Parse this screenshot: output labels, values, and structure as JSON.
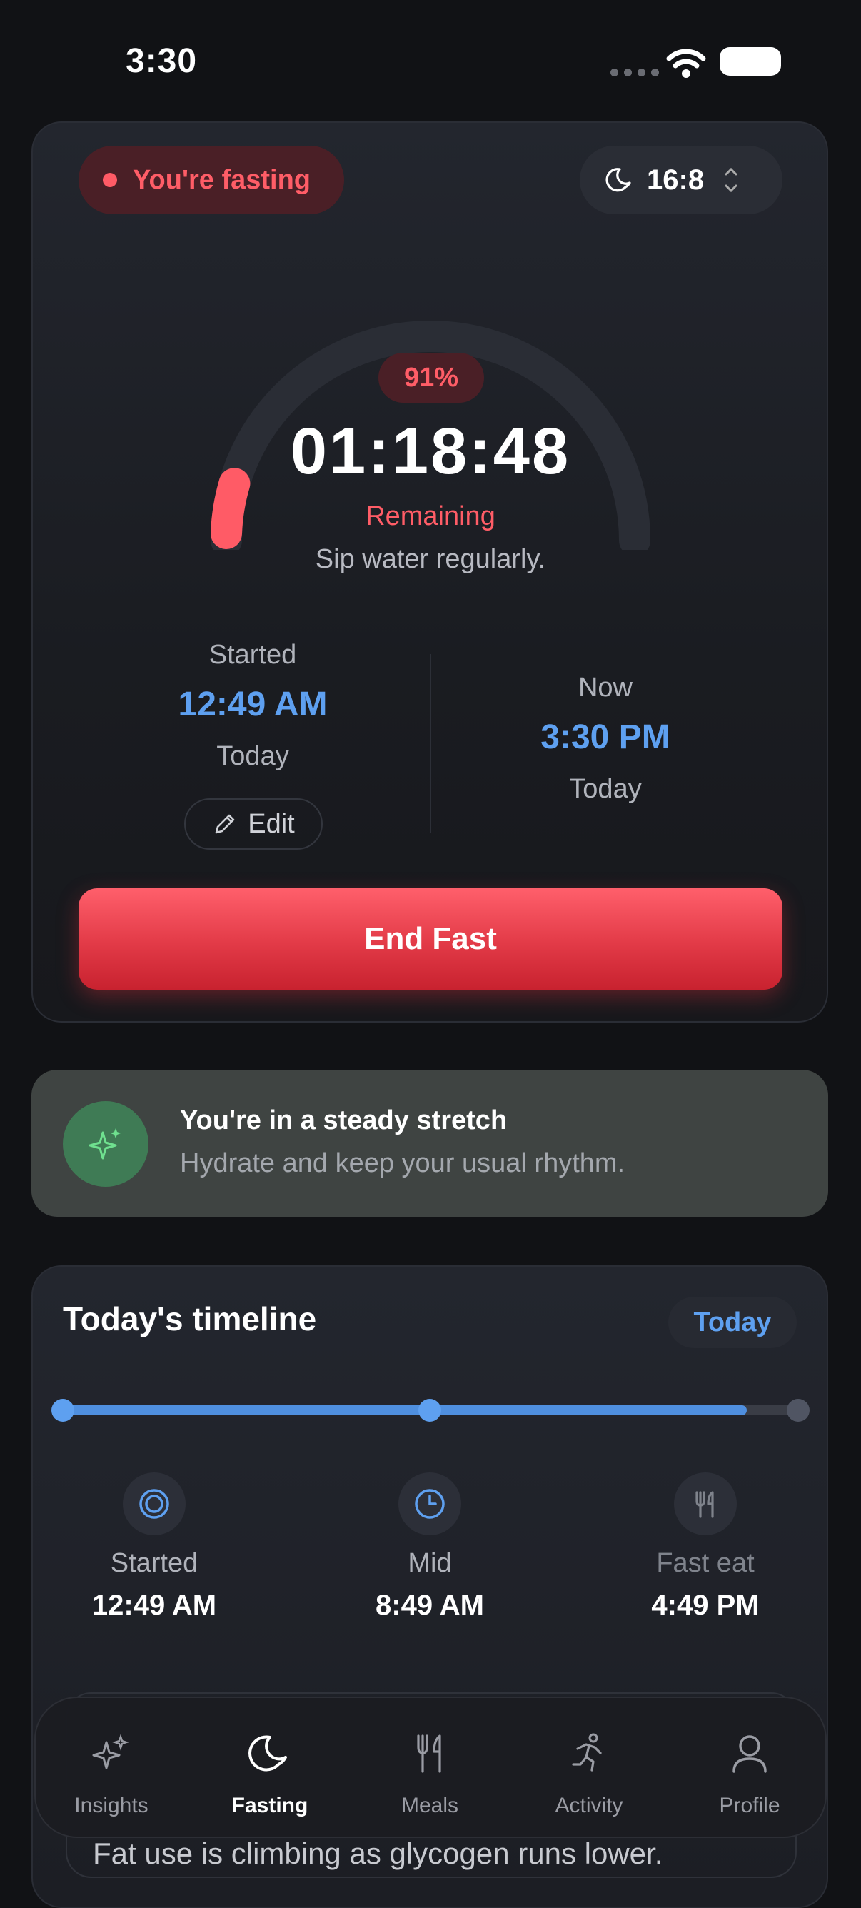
{
  "status_bar": {
    "time": "3:30"
  },
  "fasting_card": {
    "status_pill": "You're fasting",
    "plan": "16:8",
    "progress_percent_label": "91%",
    "progress_fraction": 0.91,
    "countdown": "01:18:48",
    "countdown_label": "Remaining",
    "tip": "Sip water regularly.",
    "started": {
      "label": "Started",
      "time": "12:49 AM",
      "day": "Today",
      "edit_label": "Edit"
    },
    "now": {
      "label": "Now",
      "time": "3:30 PM",
      "day": "Today"
    },
    "end_button": "End Fast",
    "colors": {
      "accent_red": "#ff5b66",
      "accent_blue": "#5ea0f0"
    }
  },
  "insight_card": {
    "title": "You're in a steady stretch",
    "subtitle": "Hydrate and keep your usual rhythm."
  },
  "timeline_card": {
    "title": "Today's timeline",
    "range_button": "Today",
    "progress_fraction": 0.93,
    "milestones": [
      {
        "label": "Started",
        "time": "12:49 AM",
        "icon": "target-icon"
      },
      {
        "label": "Mid",
        "time": "8:49 AM",
        "icon": "clock-icon"
      },
      {
        "label": "Fast eat",
        "time": "4:49 PM",
        "icon": "utensils-icon"
      }
    ],
    "partial_text": "Fat use is climbing as glycogen runs lower."
  },
  "tab_bar": {
    "tabs": [
      {
        "label": "Insights",
        "icon": "sparkles-icon"
      },
      {
        "label": "Fasting",
        "icon": "moon-icon",
        "active": true
      },
      {
        "label": "Meals",
        "icon": "utensils-icon"
      },
      {
        "label": "Activity",
        "icon": "running-icon"
      },
      {
        "label": "Profile",
        "icon": "person-icon"
      }
    ]
  }
}
